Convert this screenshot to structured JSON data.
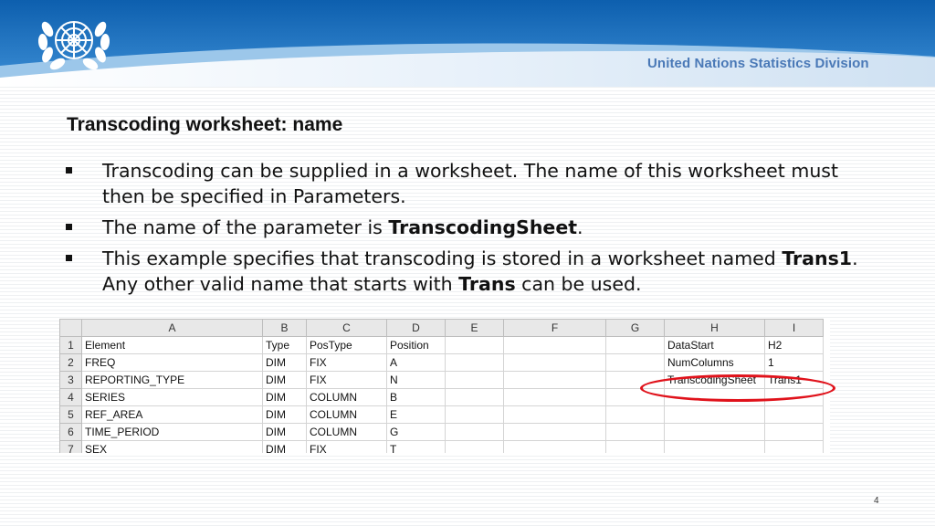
{
  "header": {
    "org_name": "United Nations Statistics Division",
    "colors": {
      "blue_dark": "#1f6fb8",
      "blue_light": "#7fb6e3",
      "org_text": "#4a79b7"
    },
    "logo": "un-emblem"
  },
  "slide": {
    "title": "Transcoding worksheet: name",
    "bullets": [
      {
        "parts": [
          "Transcoding can be supplied in a worksheet. The name of this worksheet must then be specified in Parameters."
        ]
      },
      {
        "parts": [
          "The name of the parameter is ",
          "TranscodingSheet",
          "."
        ]
      },
      {
        "parts": [
          "This example specifies that transcoding is stored in a worksheet named ",
          "Trans1",
          ". Any other valid name that starts with ",
          "Trans",
          " can be used."
        ]
      }
    ],
    "page_number": "4"
  },
  "spreadsheet": {
    "columns": [
      "A",
      "B",
      "C",
      "D",
      "E",
      "F",
      "G",
      "H",
      "I"
    ],
    "rows": [
      {
        "num": "1",
        "cells": [
          "Element",
          "Type",
          "PosType",
          "Position",
          "",
          "",
          "",
          "DataStart",
          "H2"
        ]
      },
      {
        "num": "2",
        "cells": [
          "FREQ",
          "DIM",
          "FIX",
          "A",
          "",
          "",
          "",
          "NumColumns",
          "1"
        ]
      },
      {
        "num": "3",
        "cells": [
          "REPORTING_TYPE",
          "DIM",
          "FIX",
          "N",
          "",
          "",
          "",
          "TranscodingSheet",
          "Trans1"
        ]
      },
      {
        "num": "4",
        "cells": [
          "SERIES",
          "DIM",
          "COLUMN",
          "B",
          "",
          "",
          "",
          "",
          ""
        ]
      },
      {
        "num": "5",
        "cells": [
          "REF_AREA",
          "DIM",
          "COLUMN",
          "E",
          "",
          "",
          "",
          "",
          ""
        ]
      },
      {
        "num": "6",
        "cells": [
          "TIME_PERIOD",
          "DIM",
          "COLUMN",
          "G",
          "",
          "",
          "",
          "",
          ""
        ]
      },
      {
        "num": "7",
        "cells": [
          "SEX",
          "DIM",
          "FIX",
          "T",
          "",
          "",
          "",
          "",
          ""
        ]
      }
    ],
    "highlight_color": "#e0121b"
  }
}
